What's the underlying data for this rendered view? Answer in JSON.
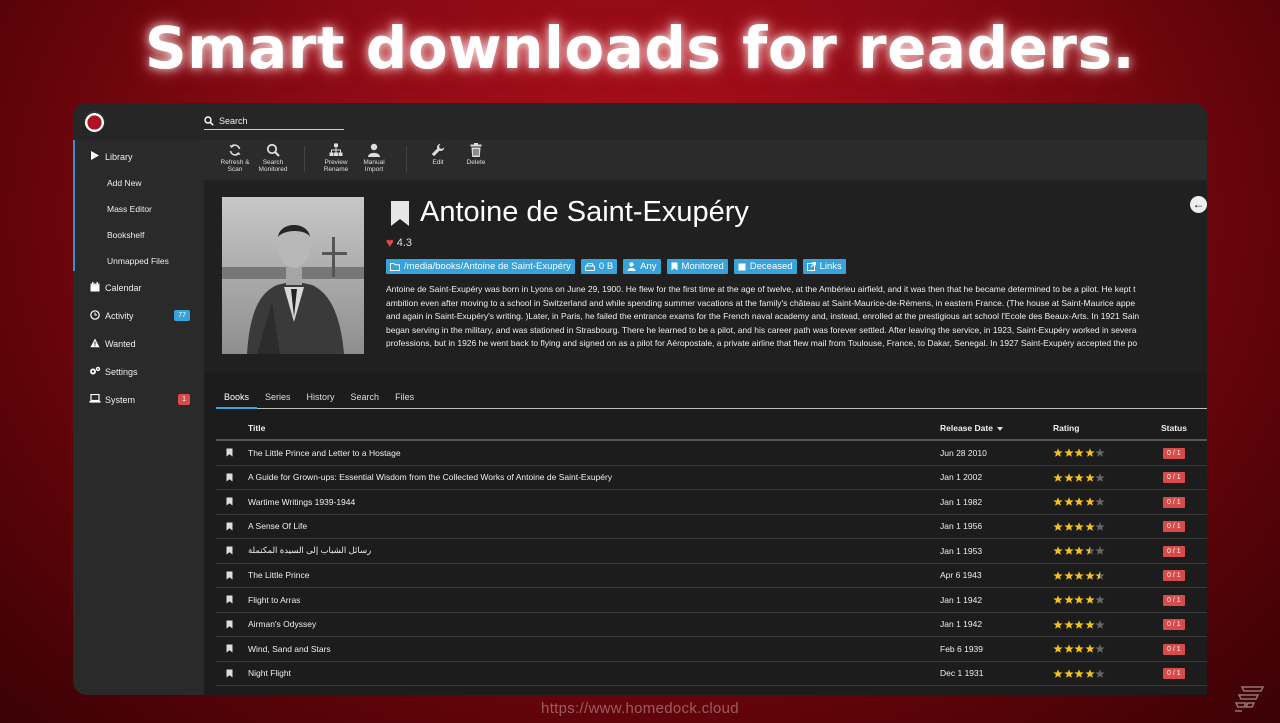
{
  "headline": "Smart downloads for readers.",
  "footer_url": "https://www.homedock.cloud",
  "search": {
    "placeholder": "Search"
  },
  "sidebar": {
    "items": [
      {
        "label": "Library",
        "icon": "play-icon"
      },
      {
        "label": "Add New"
      },
      {
        "label": "Mass Editor"
      },
      {
        "label": "Bookshelf"
      },
      {
        "label": "Unmapped Files"
      },
      {
        "label": "Calendar",
        "icon": "calendar-icon"
      },
      {
        "label": "Activity",
        "icon": "clock-icon",
        "badge": "77",
        "badge_color": "#36a3dc"
      },
      {
        "label": "Wanted",
        "icon": "warning-icon"
      },
      {
        "label": "Settings",
        "icon": "gears-icon"
      },
      {
        "label": "System",
        "icon": "laptop-icon",
        "badge": "1",
        "badge_color": "#d94b4b"
      }
    ]
  },
  "toolbar": {
    "refresh_line1": "Refresh &",
    "refresh_line2": "Scan",
    "search_line1": "Search",
    "search_line2": "Monitored",
    "preview_line1": "Preview",
    "preview_line2": "Rename",
    "manual_line1": "Manual",
    "manual_line2": "Import",
    "edit": "Edit",
    "delete": "Delete"
  },
  "author": {
    "name": "Antoine de Saint-Exupéry",
    "rating": "4.3",
    "tags": {
      "path": "/media/books/Antoine de Saint-Exupéry",
      "size": "0 B",
      "profile": "Any",
      "monitored": "Monitored",
      "status": "Deceased",
      "links": "Links"
    },
    "bio_lines": [
      "Antoine de Saint-Exupéry was born in Lyons on June 29, 1900. He flew for the first time at the age of twelve, at the Ambérieu airfield, and it was then that he became determined to be a pilot. He kept t",
      "ambition even after moving to a school in Switzerland and while spending summer vacations at the family's château at Saint-Maurice-de-Rémens, in eastern France. (The house at Saint-Maurice appe",
      "and again in Saint-Exupéry's writing. )Later, in Paris, he failed the entrance exams for the French naval academy and, instead, enrolled at the prestigious art school l'Ecole des Beaux-Arts. In 1921 Sain",
      "began serving in the military, and was stationed in Strasbourg. There he learned to be a pilot, and his career path was forever settled. After leaving the service, in 1923, Saint-Exupéry worked in severa",
      "professions, but in 1926 he went back to flying and signed on as a pilot for Aéropostale, a private airline that flew mail from Toulouse, France, to Dakar, Senegal. In 1927 Saint-Exupéry accepted the po"
    ]
  },
  "tabs": [
    "Books",
    "Series",
    "History",
    "Search",
    "Files"
  ],
  "table": {
    "columns": {
      "title": "Title",
      "release_date": "Release Date",
      "rating": "Rating",
      "status": "Status"
    },
    "rows": [
      {
        "title": "The Little Prince and Letter to a Hostage",
        "date": "Jun 28 2010",
        "stars": 4,
        "status": "0 / 1"
      },
      {
        "title": "A Guide for Grown-ups: Essential Wisdom from the Collected Works of Antoine de Saint-Exupéry",
        "date": "Jan 1 2002",
        "stars": 4,
        "status": "0 / 1"
      },
      {
        "title": "Wartime Writings 1939-1944",
        "date": "Jan 1 1982",
        "stars": 4,
        "status": "0 / 1"
      },
      {
        "title": "A Sense Of Life",
        "date": "Jan 1 1956",
        "stars": 4,
        "status": "0 / 1"
      },
      {
        "title": "رسائل الشباب إلى السيدة المكتملة",
        "date": "Jan 1 1953",
        "stars": 3.5,
        "status": "0 / 1"
      },
      {
        "title": "The Little Prince",
        "date": "Apr 6 1943",
        "stars": 4.5,
        "status": "0 / 1"
      },
      {
        "title": "Flight to Arras",
        "date": "Jan 1 1942",
        "stars": 4,
        "status": "0 / 1"
      },
      {
        "title": "Airman's Odyssey",
        "date": "Jan 1 1942",
        "stars": 4,
        "status": "0 / 1"
      },
      {
        "title": "Wind, Sand and Stars",
        "date": "Feb 6 1939",
        "stars": 4,
        "status": "0 / 1"
      },
      {
        "title": "Night Flight",
        "date": "Dec 1 1931",
        "stars": 4,
        "status": "0 / 1"
      }
    ]
  },
  "colors": {
    "accent": "#36a3dc",
    "star": "#f2c21b",
    "danger": "#d94b4b"
  }
}
